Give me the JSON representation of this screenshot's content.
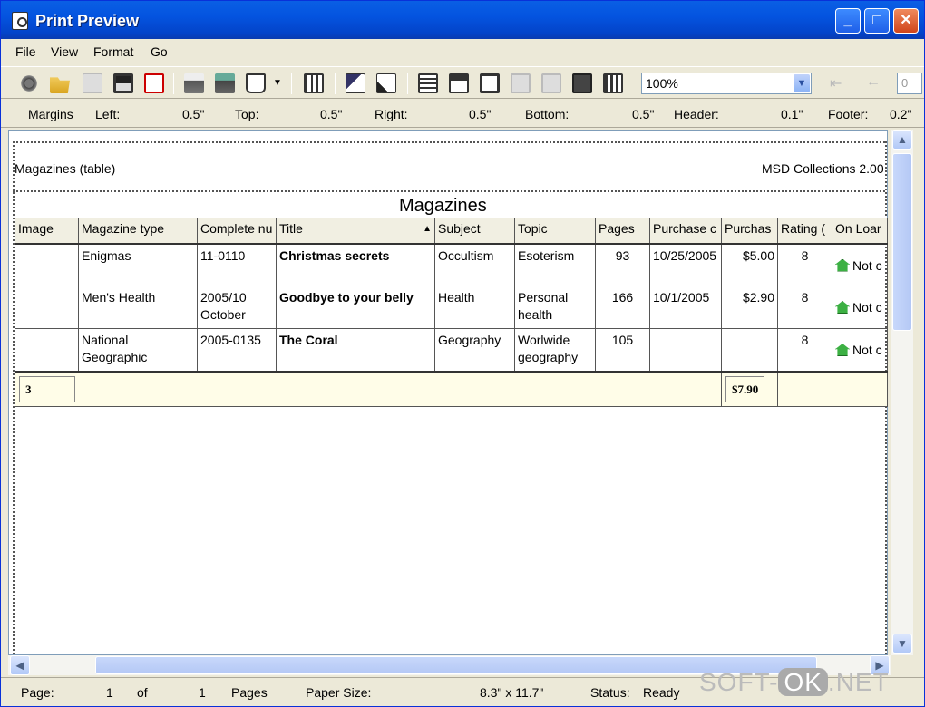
{
  "window": {
    "title": "Print Preview"
  },
  "menu": [
    "File",
    "View",
    "Format",
    "Go"
  ],
  "toolbar": {
    "zoom": "100%",
    "page_input": "0"
  },
  "margins": {
    "label": "Margins",
    "left_label": "Left:",
    "left": "0.5\"",
    "top_label": "Top:",
    "top": "0.5\"",
    "right_label": "Right:",
    "right": "0.5\"",
    "bottom_label": "Bottom:",
    "bottom": "0.5\"",
    "header_label": "Header:",
    "header": "0.1\"",
    "footer_label": "Footer:",
    "footer": "0.2\""
  },
  "report": {
    "header_left": "Magazines (table)",
    "header_right": "MSD Collections 2.00",
    "title": "Magazines",
    "columns": [
      "Image",
      "Magazine type",
      "Complete nu",
      "Title",
      "Subject",
      "Topic",
      "Pages",
      "Purchase c",
      "Purchas",
      "Rating (",
      "On Loar"
    ],
    "rows": [
      {
        "image": "",
        "type": "Enigmas",
        "number": "11-0110",
        "title": "Christmas secrets",
        "subject": "Occultism",
        "topic": "Esoterism",
        "pages": "93",
        "purchase_date": "10/25/2005",
        "price": "$5.00",
        "rating": "8",
        "loan": "Not c"
      },
      {
        "image": "",
        "type": "Men's Health",
        "number": "2005/10 October",
        "title": "Goodbye to your belly",
        "subject": "Health",
        "topic": "Personal health",
        "pages": "166",
        "purchase_date": "10/1/2005",
        "price": "$2.90",
        "rating": "8",
        "loan": "Not c"
      },
      {
        "image": "",
        "type": "National Geographic",
        "number": "2005-0135",
        "title": "The Coral",
        "subject": "Geography",
        "topic": "Worlwide geography",
        "pages": "105",
        "purchase_date": "",
        "price": "",
        "rating": "8",
        "loan": "Not c"
      }
    ],
    "footer_count": "3",
    "footer_total": "$7.90"
  },
  "status": {
    "page_label": "Page:",
    "page": "1",
    "of_label": "of",
    "total": "1",
    "pages_label": "Pages",
    "paper_label": "Paper Size:",
    "paper": "8.3\" x 11.7\"",
    "status_label": "Status:",
    "status": "Ready"
  },
  "watermark": {
    "pre": "SOFT-",
    "ok": "OK",
    "post": ".NET"
  }
}
